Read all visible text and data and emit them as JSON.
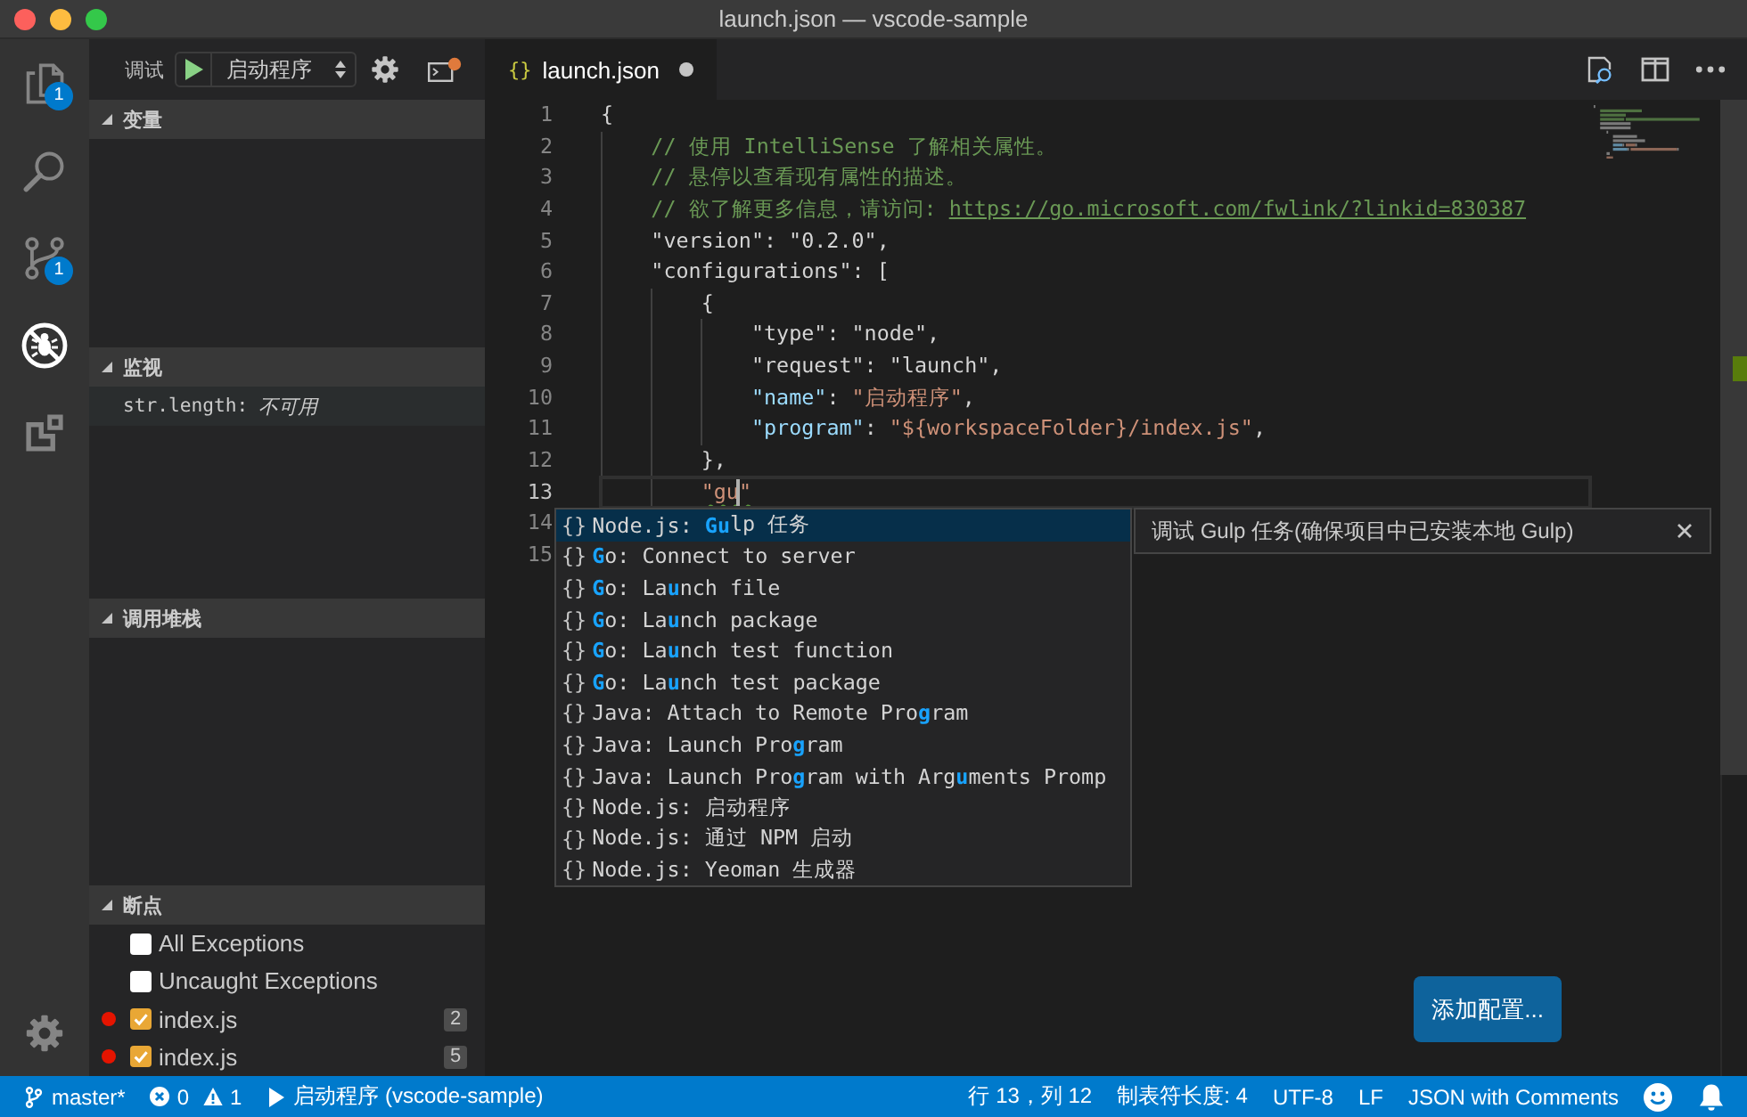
{
  "window": {
    "title": "launch.json — vscode-sample"
  },
  "activity_bar": {
    "items": [
      {
        "kind": "files",
        "selected": false,
        "badge": "1"
      },
      {
        "kind": "search",
        "selected": false
      },
      {
        "kind": "scm",
        "selected": false,
        "badge": "1"
      },
      {
        "kind": "debug",
        "selected": true
      },
      {
        "kind": "extensions",
        "selected": false
      }
    ]
  },
  "sidebar": {
    "toolbar": {
      "label": "调试",
      "configuration": "启动程序"
    },
    "sections": [
      {
        "kind": "variables",
        "title": "变量",
        "expanded": true
      },
      {
        "kind": "watch",
        "title": "监视",
        "expanded": true,
        "expressions": [
          {
            "name": "str.length:",
            "value": "不可用"
          }
        ]
      },
      {
        "kind": "callstack",
        "title": "调用堆栈",
        "expanded": true
      },
      {
        "kind": "breakpoints",
        "title": "断点",
        "expanded": true,
        "items": [
          {
            "kind": "exception",
            "label": "All Exceptions",
            "checked": false
          },
          {
            "kind": "exception",
            "label": "Uncaught Exceptions",
            "checked": false
          },
          {
            "kind": "file",
            "label": "index.js",
            "checked": true,
            "line": "2"
          },
          {
            "kind": "file",
            "label": "index.js",
            "checked": true,
            "line": "5"
          }
        ]
      }
    ]
  },
  "editor": {
    "tabs": [
      {
        "icon": "{}",
        "label": "launch.json",
        "selected": true,
        "dirty": true
      }
    ],
    "lines": [
      {
        "number": "1",
        "current": false,
        "tokens": [
          {
            "kind": "plain",
            "text": "{"
          }
        ]
      },
      {
        "number": "2",
        "current": false,
        "tokens": [
          {
            "kind": "comment",
            "text": "    // 使用 IntelliSense 了解相关属性。"
          }
        ]
      },
      {
        "number": "3",
        "current": false,
        "tokens": [
          {
            "kind": "comment",
            "text": "    // 悬停以查看现有属性的描述。"
          }
        ]
      },
      {
        "number": "4",
        "current": false,
        "tokens": [
          {
            "kind": "comment",
            "text": "    // 欲了解更多信息，请访问: "
          },
          {
            "kind": "link",
            "text": "https://go.microsoft.com/fwlink/?linkid=830387"
          }
        ]
      },
      {
        "number": "5",
        "current": false,
        "tokens": [
          {
            "kind": "plain",
            "text": "    \"version\": \"0.2.0\","
          }
        ]
      },
      {
        "number": "6",
        "current": false,
        "tokens": [
          {
            "kind": "plain",
            "text": "    \"configurations\": ["
          }
        ]
      },
      {
        "number": "7",
        "current": false,
        "tokens": [
          {
            "kind": "plain",
            "text": "        {"
          }
        ]
      },
      {
        "number": "8",
        "current": false,
        "tokens": [
          {
            "kind": "plain",
            "text": "            \"type\": \"node\","
          }
        ]
      },
      {
        "number": "9",
        "current": false,
        "tokens": [
          {
            "kind": "plain",
            "text": "            \"request\": \"launch\","
          }
        ]
      },
      {
        "number": "10",
        "current": false,
        "tokens": [
          {
            "kind": "key",
            "text": "            \"name\""
          },
          {
            "kind": "plain",
            "text": ": "
          },
          {
            "kind": "string",
            "text": "\"启动程序\""
          },
          {
            "kind": "plain",
            "text": ","
          }
        ]
      },
      {
        "number": "11",
        "current": false,
        "tokens": [
          {
            "kind": "key",
            "text": "            \"program\""
          },
          {
            "kind": "plain",
            "text": ": "
          },
          {
            "kind": "string",
            "text": "\"${workspaceFolder}/index.js\""
          },
          {
            "kind": "plain",
            "text": ","
          }
        ]
      },
      {
        "number": "12",
        "current": false,
        "tokens": [
          {
            "kind": "plain",
            "text": "        },"
          }
        ]
      },
      {
        "number": "13",
        "current": true,
        "tokens": [
          {
            "kind": "invalid",
            "text": "        \"gu"
          },
          {
            "kind": "cursor"
          },
          {
            "kind": "invalid",
            "text": "\""
          }
        ]
      },
      {
        "number": "14",
        "current": false
      },
      {
        "number": "15",
        "current": false
      }
    ],
    "suggestions": {
      "items": [
        {
          "icon": "{}",
          "label": "Node.js: **Gu**lp 任务",
          "selected": true
        },
        {
          "icon": "{}",
          "label": "**G**o: Connect to server",
          "selected": false
        },
        {
          "icon": "{}",
          "label": "**G**o: La**u**nch file",
          "selected": false
        },
        {
          "icon": "{}",
          "label": "**G**o: La**u**nch package",
          "selected": false
        },
        {
          "icon": "{}",
          "label": "**G**o: La**u**nch test function",
          "selected": false
        },
        {
          "icon": "{}",
          "label": "**G**o: La**u**nch test package",
          "selected": false
        },
        {
          "icon": "{}",
          "label": "Java: Attach to Remote Pro**g**ram",
          "selected": false
        },
        {
          "icon": "{}",
          "label": "Java: Launch Pro**g**ram",
          "selected": false
        },
        {
          "icon": "{}",
          "label": "Java: Launch Pro**g**ram with Arg**u**ments Promp",
          "selected": false
        },
        {
          "icon": "{}",
          "label": "Node.js: 启动程序",
          "selected": false
        },
        {
          "icon": "{}",
          "label": "Node.js: 通过 NPM 启动",
          "selected": false
        },
        {
          "icon": "{}",
          "label": "Node.js: Yeoman 生成器",
          "selected": false
        }
      ],
      "details": "调试 Gulp 任务(确保项目中已安装本地 Gulp)"
    },
    "add_button": "添加配置..."
  },
  "status_bar": {
    "left": [
      {
        "kind": "branch",
        "text": "master*"
      },
      {
        "kind": "problems",
        "errors": "0",
        "warnings": "1"
      },
      {
        "kind": "launch",
        "text": "启动程序 (vscode-sample)"
      }
    ],
    "right": [
      {
        "kind": "text",
        "text": "行 13，列 12"
      },
      {
        "kind": "text",
        "text": "制表符长度: 4"
      },
      {
        "kind": "text",
        "text": "UTF-8"
      },
      {
        "kind": "text",
        "text": "LF"
      },
      {
        "kind": "text",
        "text": "JSON with Comments"
      },
      {
        "kind": "smiley"
      },
      {
        "kind": "bell"
      }
    ]
  }
}
